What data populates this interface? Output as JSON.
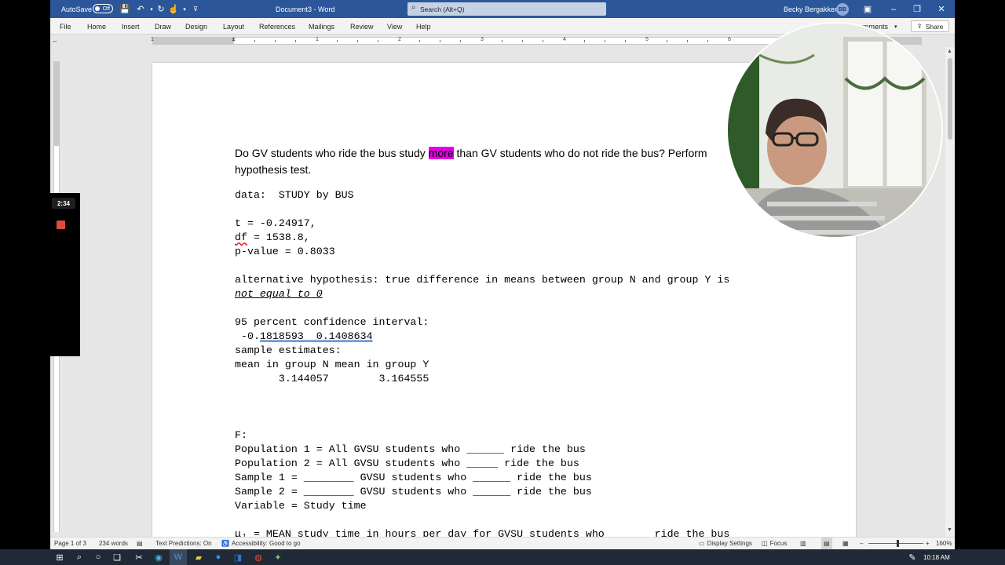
{
  "titlebar": {
    "autosave_label": "AutoSave",
    "autosave_state": "Off",
    "document_title": "Document3 - Word",
    "search_placeholder": "Search (Alt+Q)",
    "user_name": "Becky Bergakker",
    "user_initials": "BB"
  },
  "ribbon": {
    "tabs": [
      "File",
      "Home",
      "Insert",
      "Draw",
      "Design",
      "Layout",
      "References",
      "Mailings",
      "Review",
      "View",
      "Help"
    ],
    "comments_label": "omments",
    "share_label": "Share"
  },
  "ruler": {
    "numbers": [
      "1",
      "1",
      "2",
      "3",
      "4",
      "5",
      "6"
    ]
  },
  "document": {
    "line1_a": "Do GV students who ride the bus study ",
    "line1_highlight": "more",
    "line1_b": " than GV students who do not ride the bus? Perform",
    "line2": "hypothesis test.",
    "data_line": "data:  STUDY by BUS",
    "t_line": "t = -0.24917,",
    "df_word": "df",
    "df_rest": " = 1538.8,",
    "p_line": "p-value = 0.8033",
    "alt_line": "alternative hypothesis: true difference in means between group N and group Y is",
    "alt_line2": "not equal to 0",
    "ci_label": "95 percent confidence interval:",
    "ci_a": " -0.",
    "ci_b": "1818593  0.1408634",
    "se_label": "sample estimates:",
    "means_header": "mean in group N mean in group Y",
    "means_values": "       3.144057        3.164555",
    "f_label": "F:",
    "pop1": "Population 1 = All GVSU students who ______ ride the bus",
    "pop2": "Population 2 = All GVSU students who _____ ride the bus",
    "samp1": "Sample 1 = ________ GVSU students who ______ ride the bus",
    "samp2": "Sample 2 = ________ GVSU students who ______ ride the bus",
    "variable": "Variable = Study time",
    "mu1": "μ₁ = MEAN study time in hours per day for GVSU students who ______ ride the bus"
  },
  "statusbar": {
    "page": "Page 1 of 3",
    "words": "234 words",
    "text_predictions": "Text Predictions: On",
    "accessibility": "Accessibility: Good to go",
    "display_settings": "Display Settings",
    "focus": "Focus",
    "zoom": "160%"
  },
  "recording": {
    "elapsed": "2:34"
  },
  "taskbar": {
    "time": "10:18 AM"
  },
  "colors": {
    "word_blue": "#2b579a",
    "highlight": "#e400e4",
    "taskbar": "#202a36"
  }
}
